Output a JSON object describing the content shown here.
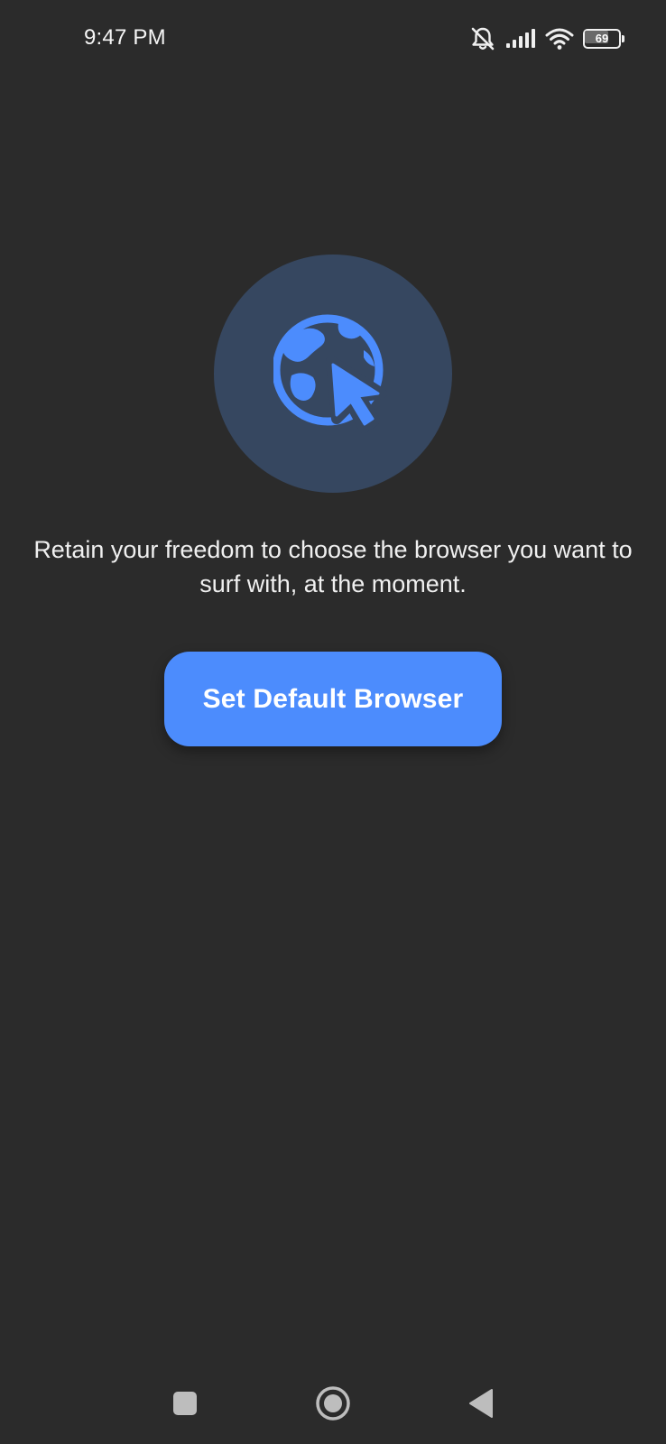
{
  "status_bar": {
    "time": "9:47 PM",
    "battery_level": "69",
    "icons": [
      "notifications-off-icon",
      "signal-icon",
      "wifi-icon",
      "battery-icon"
    ]
  },
  "hero": {
    "icon": "globe-cursor-icon",
    "circle_color": "#364760",
    "icon_color": "#4c8cfd"
  },
  "main": {
    "description": "Retain your freedom to choose the browser you want to surf with, at the moment.",
    "primary_button_label": "Set Default Browser"
  },
  "nav_bar": {
    "recents_icon": "square-icon",
    "home_icon": "circle-icon",
    "back_icon": "triangle-back-icon"
  },
  "colors": {
    "background": "#2b2b2b",
    "accent": "#4c8cfd",
    "text": "#f0f0f0"
  }
}
